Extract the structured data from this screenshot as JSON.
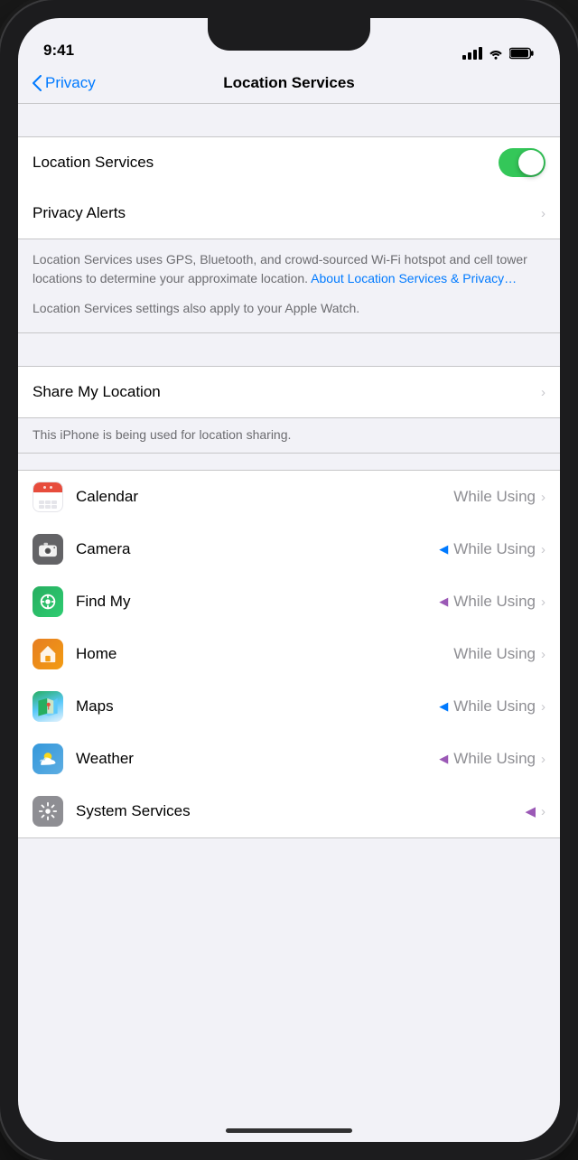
{
  "statusBar": {
    "time": "9:41"
  },
  "nav": {
    "backLabel": "Privacy",
    "title": "Location Services"
  },
  "locationServices": {
    "label": "Location Services",
    "enabled": true
  },
  "privacyAlerts": {
    "label": "Privacy Alerts"
  },
  "description": {
    "text": "Location Services uses GPS, Bluetooth, and crowd-sourced Wi-Fi hotspot and cell tower locations to determine your approximate location. ",
    "linkText": "About Location Services & Privacy…",
    "watchText": "Location Services settings also apply to your Apple Watch."
  },
  "shareMyLocation": {
    "label": "Share My Location",
    "subtext": "This iPhone is being used for location sharing."
  },
  "apps": [
    {
      "name": "Calendar",
      "value": "While Using",
      "iconType": "calendar",
      "hasArrow": false
    },
    {
      "name": "Camera",
      "value": "While Using",
      "iconType": "camera",
      "hasArrow": true,
      "arrowColor": "blue"
    },
    {
      "name": "Find My",
      "value": "While Using",
      "iconType": "findmy",
      "hasArrow": true,
      "arrowColor": "purple"
    },
    {
      "name": "Home",
      "value": "While Using",
      "iconType": "home",
      "hasArrow": false
    },
    {
      "name": "Maps",
      "value": "While Using",
      "iconType": "maps",
      "hasArrow": true,
      "arrowColor": "blue"
    },
    {
      "name": "Weather",
      "value": "While Using",
      "iconType": "weather",
      "hasArrow": true,
      "arrowColor": "purple"
    },
    {
      "name": "System Services",
      "value": "",
      "iconType": "system",
      "hasArrow": false,
      "hasArrowPurple": true
    }
  ],
  "colors": {
    "toggleOn": "#34c759",
    "blue": "#007aff",
    "purple": "#9b59b6"
  }
}
